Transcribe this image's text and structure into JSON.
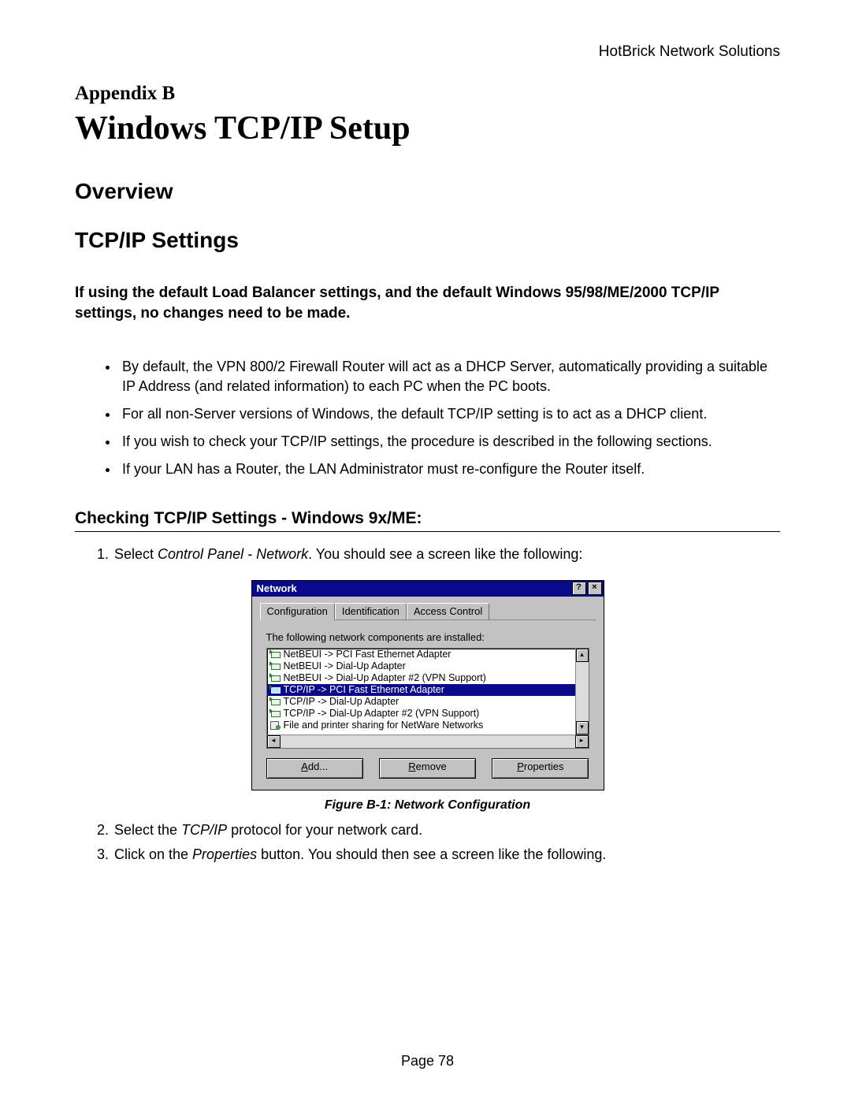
{
  "header": {
    "brand": "HotBrick Network Solutions"
  },
  "appendix": "Appendix B",
  "title": "Windows TCP/IP Setup",
  "h2": "Overview",
  "h3": "TCP/IP Settings",
  "lead": "If using the default Load Balancer settings, and the default Windows 95/98/ME/2000 TCP/IP settings, no changes need to be made.",
  "bul": [
    "By default, the VPN 800/2 Firewall Router will act as a DHCP Server, automatically providing a suitable IP Address (and related information) to each PC when the PC boots.",
    "For all non-Server versions of Windows, the default TCP/IP setting is to act as a DHCP client.",
    "If you wish to check your TCP/IP settings, the procedure is described in the following sections.",
    "If your LAN has a Router, the LAN Administrator must re-configure the Router itself."
  ],
  "subhead": "Checking TCP/IP Settings - Windows 9x/ME:",
  "ol1": {
    "pre": "Select ",
    "em": "Control Panel - Network",
    "post": ". You should see a screen like the following:"
  },
  "dialog": {
    "title": "Network",
    "helpbtn": "?",
    "closebtn": "×",
    "tabs": [
      "Configuration",
      "Identification",
      "Access Control"
    ],
    "label": "The following network components are installed:",
    "items": [
      {
        "icon": "nic",
        "text": "NetBEUI -> PCI Fast Ethernet Adapter",
        "sel": false
      },
      {
        "icon": "nic",
        "text": "NetBEUI -> Dial-Up Adapter",
        "sel": false
      },
      {
        "icon": "nic",
        "text": "NetBEUI -> Dial-Up Adapter #2 (VPN Support)",
        "sel": false
      },
      {
        "icon": "nic",
        "text": "TCP/IP -> PCI Fast Ethernet Adapter",
        "sel": true
      },
      {
        "icon": "nic",
        "text": "TCP/IP -> Dial-Up Adapter",
        "sel": false
      },
      {
        "icon": "nic",
        "text": "TCP/IP -> Dial-Up Adapter #2 (VPN Support)",
        "sel": false
      },
      {
        "icon": "svc",
        "text": "File and printer sharing for NetWare Networks",
        "sel": false
      }
    ],
    "scroll": {
      "up": "▴",
      "down": "▾",
      "left": "◂",
      "right": "▸"
    },
    "buttons": {
      "add_u": "A",
      "add_rest": "dd...",
      "rem_u": "R",
      "rem_rest": "emove",
      "prop_u": "P",
      "prop_rest": "roperties"
    }
  },
  "caption": "Figure B-1: Network Configuration",
  "ol2": {
    "pre": "Select the ",
    "em": "TCP/IP",
    "post": " protocol for your network card."
  },
  "ol3": {
    "pre": "Click on the ",
    "em": "Properties",
    "post": " button. You should then see a screen like the following."
  },
  "footer": "Page 78"
}
